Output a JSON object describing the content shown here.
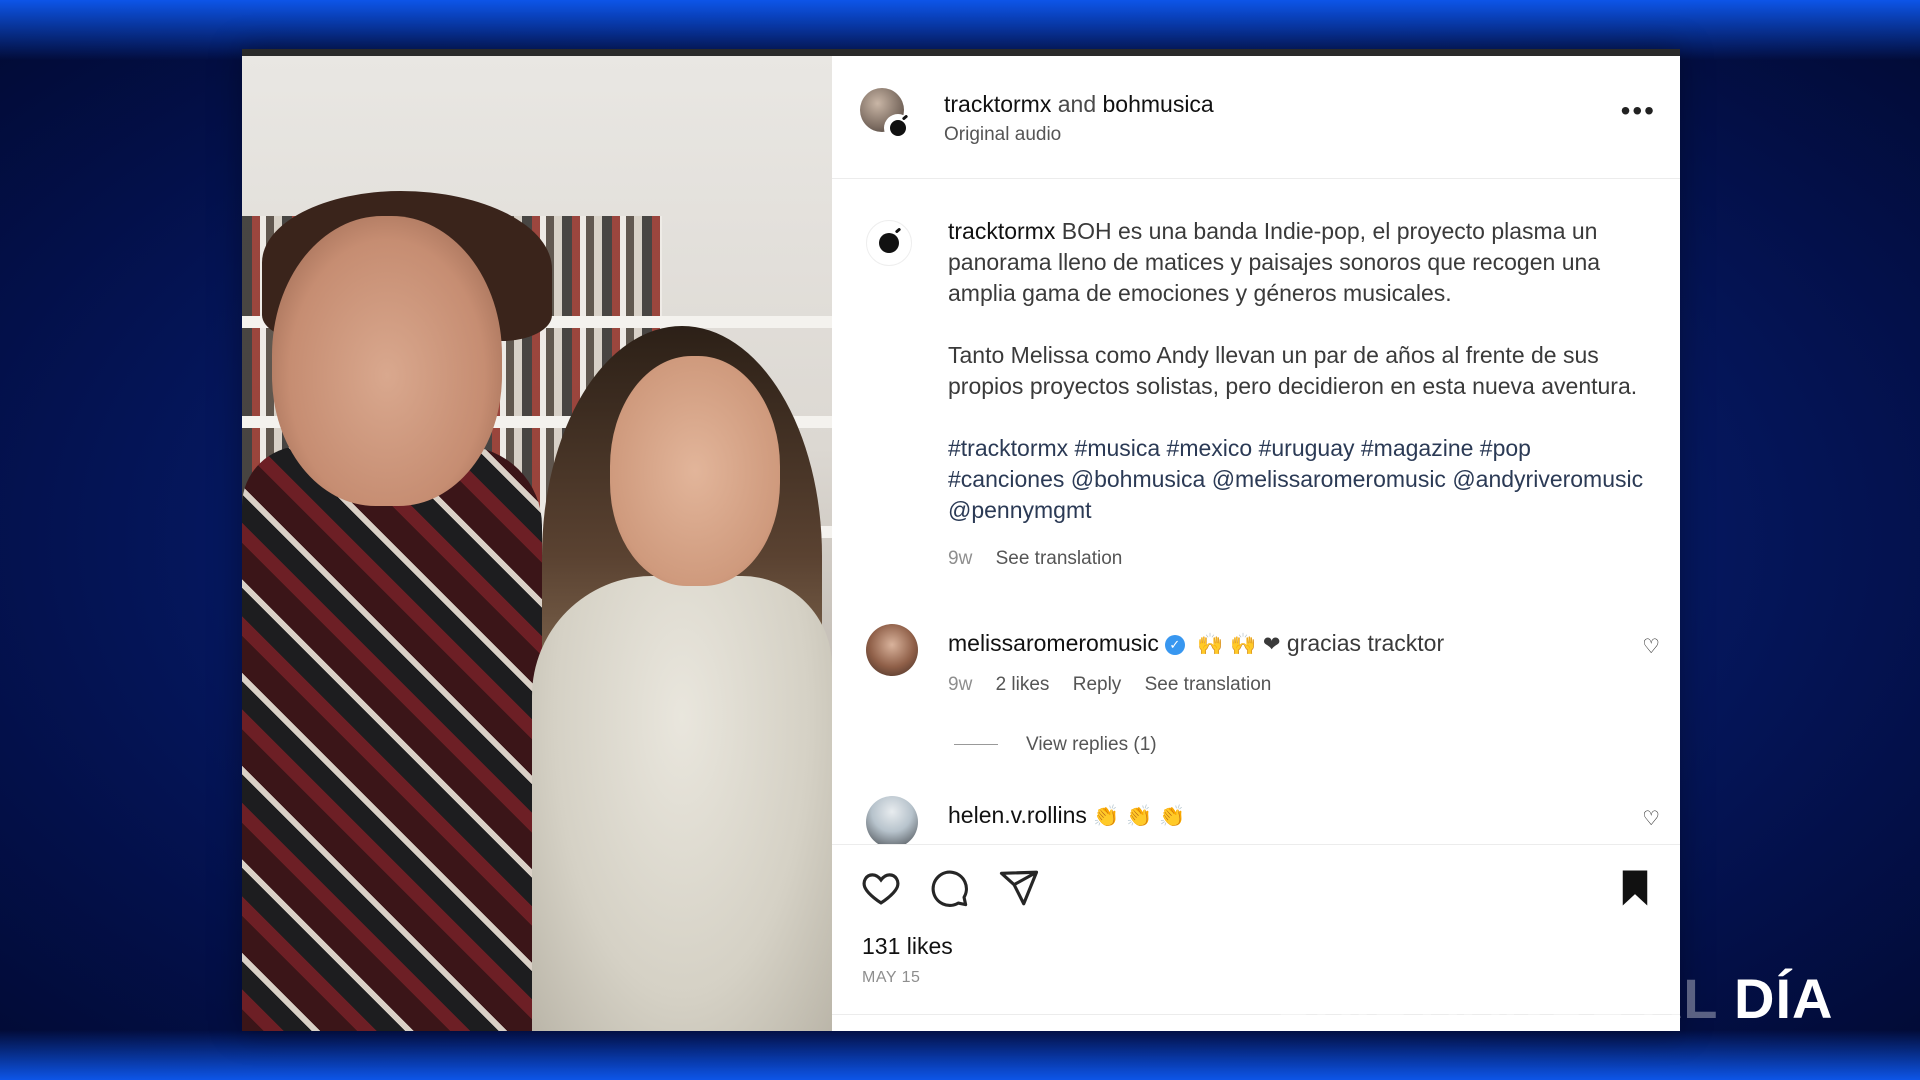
{
  "post": {
    "header": {
      "user1": "tracktormx",
      "connector": "and",
      "user2": "bohmusica",
      "audio": "Original audio",
      "more": "..."
    },
    "caption": {
      "user": "tracktormx",
      "paragraph1": "BOH es una banda Indie-pop, el proyecto plasma un panorama lleno de matices y paisajes sonoros que recogen una amplia gama de emociones y géneros musicales.",
      "paragraph2": "Tanto Melissa como Andy llevan un par de años al frente de sus propios proyectos solistas, pero decidieron en esta nueva aventura.",
      "tags": "#tracktormx #musica #mexico #uruguay #magazine #pop #canciones @bohmusica @melissaromeromusic @andyriveromusic @pennymgmt",
      "time": "9w",
      "see_translation": "See translation"
    },
    "comments": [
      {
        "user": "melissaromeromusic",
        "emojis": "🙌 🙌 ❤",
        "text": "gracias tracktor",
        "time": "9w",
        "likes": "2 likes",
        "reply": "Reply",
        "see_translation": "See translation",
        "view_replies": "View replies (1)"
      },
      {
        "user": "helen.v.rollins",
        "emojis": "👏 👏 👏"
      }
    ],
    "likes": "131 likes",
    "date": "MAY 15"
  },
  "watermark": {
    "part1": "CRISTIANOS AL",
    "part2": "DÍA"
  },
  "icons": [
    "heart-icon",
    "comment-icon",
    "share-icon",
    "bookmark-icon",
    "more-icon"
  ],
  "colors": {
    "verified": "#3897f0",
    "background": "#061a66"
  }
}
